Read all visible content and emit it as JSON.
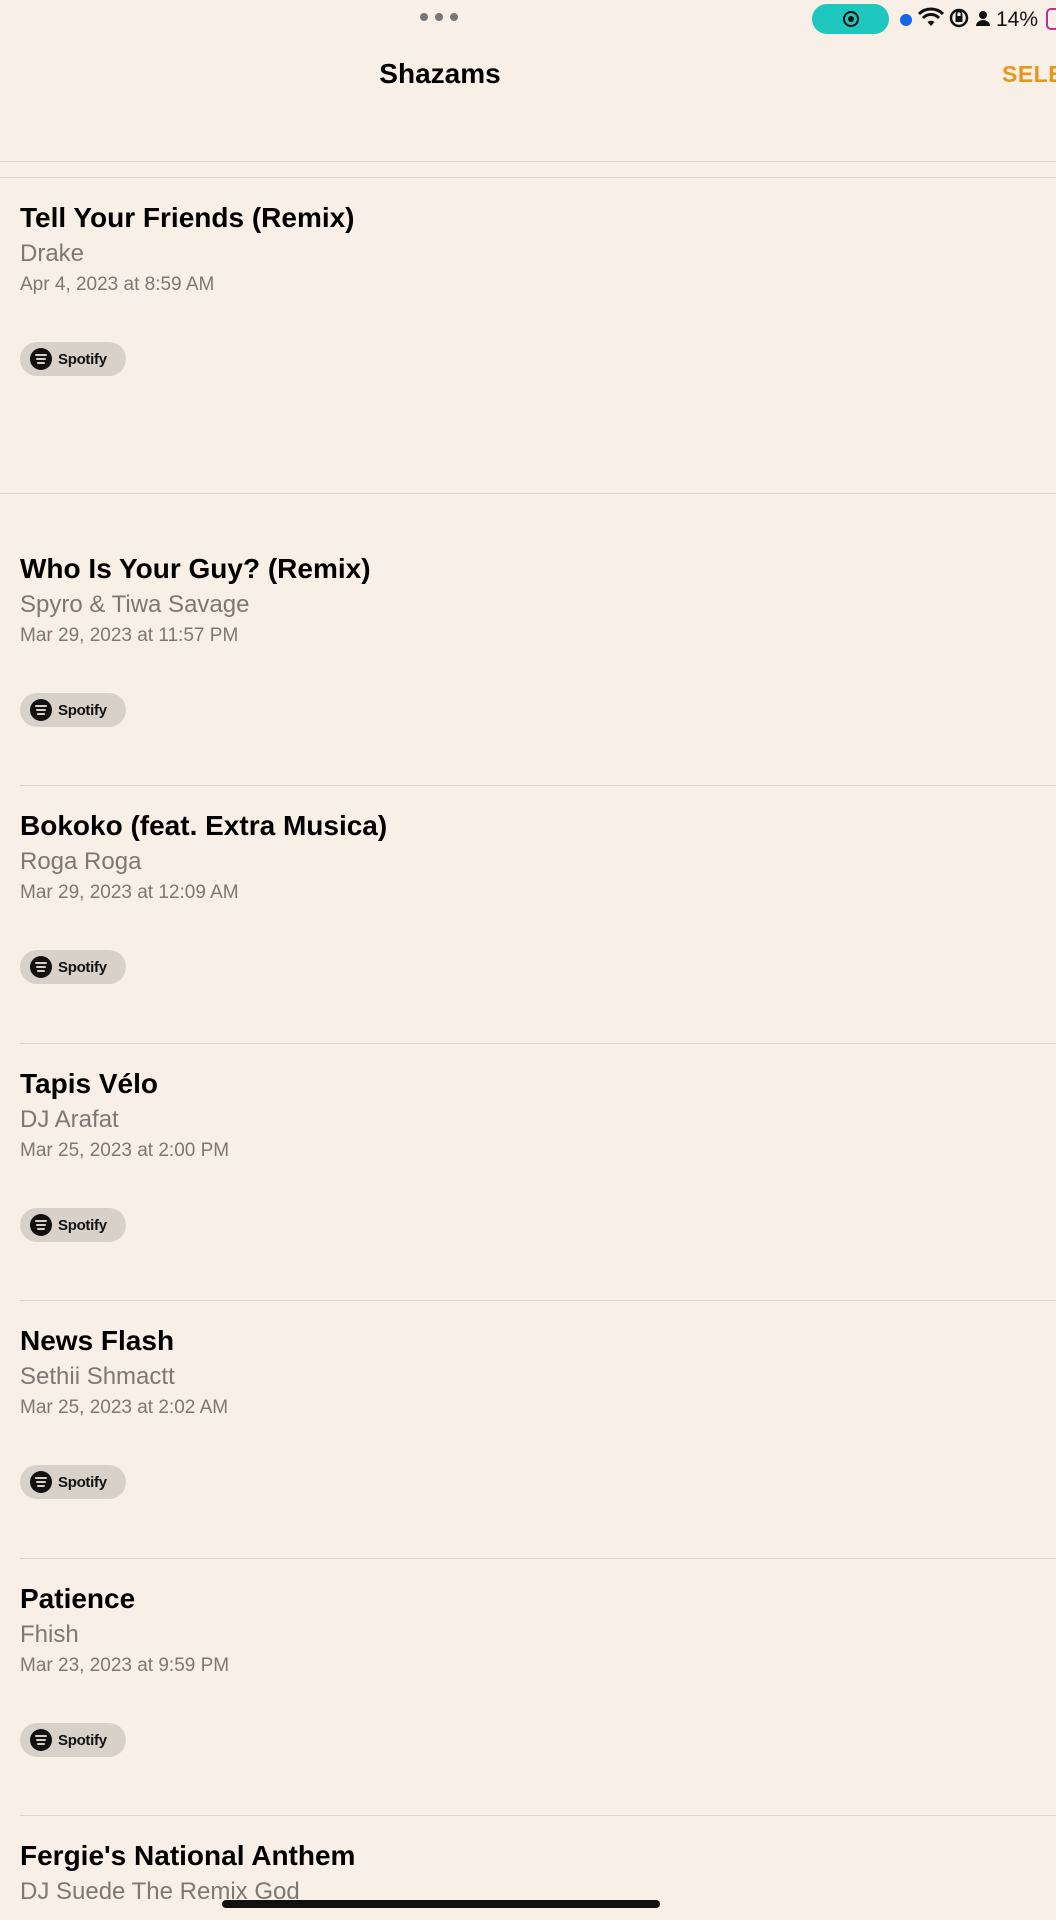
{
  "status_bar": {
    "battery_percent": "14%",
    "icons": [
      "more-dots-icon",
      "screen-record-icon",
      "mic-indicator-icon",
      "wifi-icon",
      "orientation-lock-icon",
      "person-icon",
      "battery-icon"
    ]
  },
  "header": {
    "title": "Shazams",
    "select_label": "SELE"
  },
  "colors": {
    "background": "#f8efe6",
    "accent": "#e8951e",
    "record_pill": "#1ec7bd"
  },
  "items": [
    {
      "title": "Tell Your Friends (Remix)",
      "artist": "Drake",
      "date": "Apr 4, 2023 at 8:59 AM",
      "service": "Spotify"
    },
    {
      "title": "Who Is Your Guy? (Remix)",
      "artist": "Spyro & Tiwa Savage",
      "date": "Mar 29, 2023 at 11:57 PM",
      "service": "Spotify"
    },
    {
      "title": "Bokoko (feat. Extra Musica)",
      "artist": "Roga Roga",
      "date": "Mar 29, 2023 at 12:09 AM",
      "service": "Spotify"
    },
    {
      "title": "Tapis Vélo",
      "artist": "DJ Arafat",
      "date": "Mar 25, 2023 at 2:00 PM",
      "service": "Spotify"
    },
    {
      "title": "News Flash",
      "artist": "Sethii Shmactt",
      "date": "Mar 25, 2023 at 2:02 AM",
      "service": "Spotify"
    },
    {
      "title": "Patience",
      "artist": "Fhish",
      "date": "Mar 23, 2023 at 9:59 PM",
      "service": "Spotify"
    },
    {
      "title": "Fergie's National Anthem",
      "artist": "DJ Suede The Remix God"
    }
  ]
}
